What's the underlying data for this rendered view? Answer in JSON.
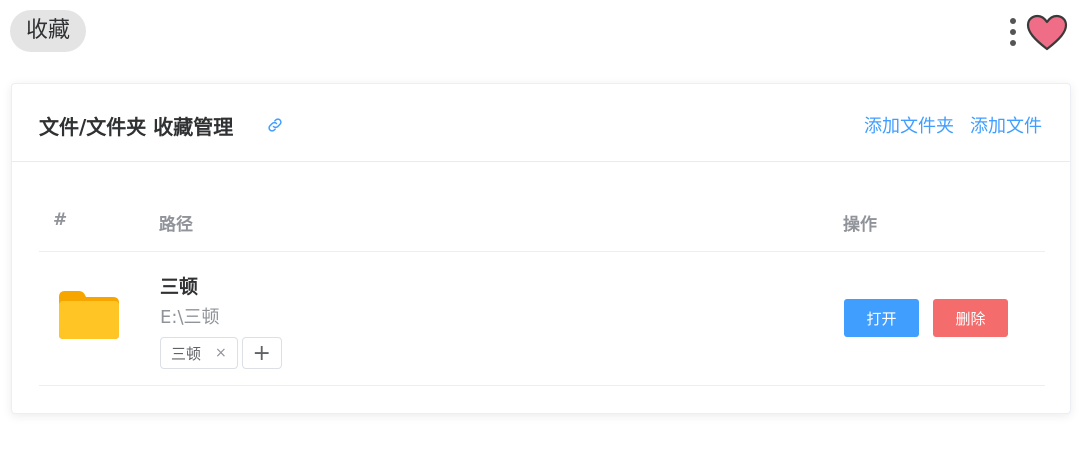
{
  "page": {
    "title": "收藏"
  },
  "card": {
    "title": "文件/文件夹 收藏管理",
    "actions": {
      "add_folder": "添加文件夹",
      "add_file": "添加文件"
    }
  },
  "table": {
    "columns": {
      "index": "#",
      "path": "路径",
      "actions": "操作"
    },
    "rows": [
      {
        "icon": "folder-icon",
        "name": "三顿",
        "path": "E:\\三顿",
        "tags": [
          {
            "label": "三顿",
            "close": "×"
          }
        ],
        "add_tag": "+",
        "buttons": {
          "open": "打开",
          "delete": "删除"
        }
      }
    ]
  },
  "colors": {
    "primary": "#409eff",
    "danger": "#f56c6c",
    "folder": "#ffc524",
    "heart": "#f06d87"
  }
}
